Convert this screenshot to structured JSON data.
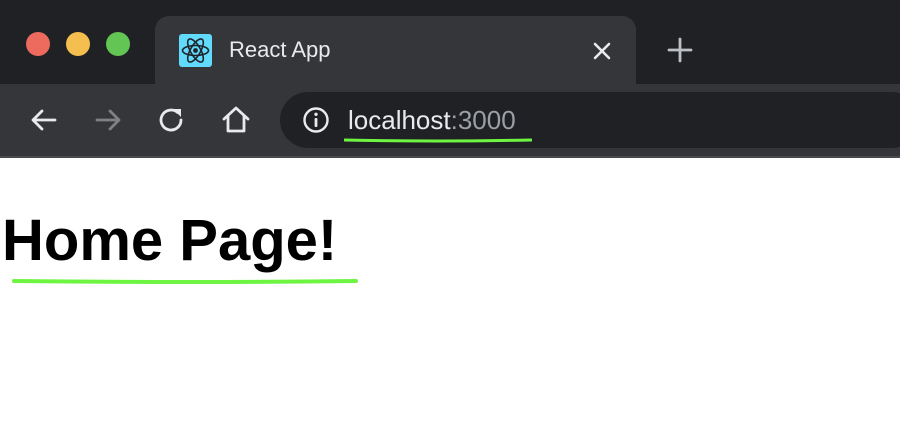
{
  "browser": {
    "tab": {
      "title": "React App",
      "favicon": "react-logo-icon"
    },
    "address_bar": {
      "host": "localhost",
      "port": ":3000"
    },
    "icons": {
      "back": "arrow-left-icon",
      "forward": "arrow-right-icon",
      "reload": "reload-icon",
      "home": "home-icon",
      "info": "info-icon",
      "close_tab": "close-icon",
      "new_tab": "plus-icon"
    },
    "colors": {
      "window_controls": [
        "#ed6a5e",
        "#f5bf4f",
        "#62c554"
      ],
      "highlight": "#6ef542"
    }
  },
  "page": {
    "heading": "Home Page!"
  }
}
